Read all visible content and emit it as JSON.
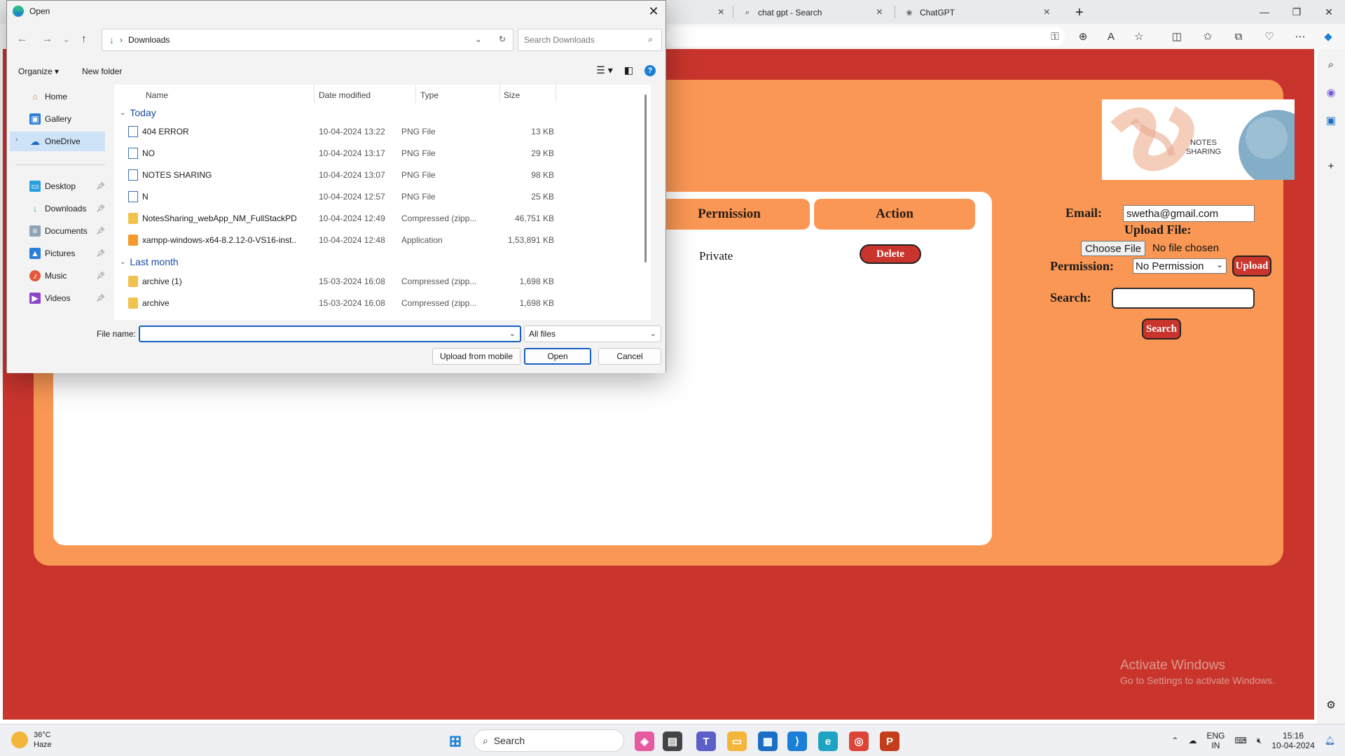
{
  "browser": {
    "tabs": [
      {
        "title": "",
        "icon": "close-icon"
      },
      {
        "title": "chat gpt - Search",
        "icon": "search-icon"
      },
      {
        "title": "ChatGPT",
        "icon": "chatgpt-icon"
      }
    ],
    "new_tab": "+"
  },
  "page": {
    "logo_text": "NOTES\nSHARING",
    "table": {
      "headers": [
        "Permission",
        "Action"
      ],
      "rows": [
        {
          "permission": "Private",
          "action": "Delete"
        }
      ]
    },
    "form": {
      "email_label": "Email:",
      "email_value": "swetha@gmail.com",
      "upload_label": "Upload File:",
      "choose_file": "Choose File",
      "no_file": "No file chosen",
      "permission_label": "Permission:",
      "permission_value": "No Permission",
      "upload_button": "Upload",
      "search_label": "Search:",
      "search_button": "Search"
    },
    "activate": {
      "line1": "Activate Windows",
      "line2": "Go to Settings to activate Windows."
    }
  },
  "dialog": {
    "title": "Open",
    "breadcrumb": "Downloads",
    "search_placeholder": "Search Downloads",
    "organize": "Organize",
    "new_folder": "New folder",
    "nav": {
      "home": "Home",
      "gallery": "Gallery",
      "onedrive": "OneDrive",
      "desktop": "Desktop",
      "downloads": "Downloads",
      "documents": "Documents",
      "pictures": "Pictures",
      "music": "Music",
      "videos": "Videos"
    },
    "columns": {
      "name": "Name",
      "date": "Date modified",
      "type": "Type",
      "size": "Size"
    },
    "groups": {
      "today": "Today",
      "last_month": "Last month"
    },
    "files_today": [
      {
        "name": "404 ERROR",
        "date": "10-04-2024 13:22",
        "type": "PNG File",
        "size": "13 KB",
        "kind": "png"
      },
      {
        "name": "NO",
        "date": "10-04-2024 13:17",
        "type": "PNG File",
        "size": "29 KB",
        "kind": "png"
      },
      {
        "name": "NOTES SHARING",
        "date": "10-04-2024 13:07",
        "type": "PNG File",
        "size": "98 KB",
        "kind": "png"
      },
      {
        "name": "N",
        "date": "10-04-2024 12:57",
        "type": "PNG File",
        "size": "25 KB",
        "kind": "png"
      },
      {
        "name": "NotesSharing_webApp_NM_FullStackPDj...",
        "date": "10-04-2024 12:49",
        "type": "Compressed (zipp...",
        "size": "46,751 KB",
        "kind": "zip"
      },
      {
        "name": "xampp-windows-x64-8.2.12-0-VS16-inst...",
        "date": "10-04-2024 12:48",
        "type": "Application",
        "size": "1,53,891 KB",
        "kind": "exe"
      }
    ],
    "files_last_month": [
      {
        "name": "archive (1)",
        "date": "15-03-2024 16:08",
        "type": "Compressed (zipp...",
        "size": "1,698 KB",
        "kind": "zip"
      },
      {
        "name": "archive",
        "date": "15-03-2024 16:08",
        "type": "Compressed (zipp...",
        "size": "1,698 KB",
        "kind": "zip"
      }
    ],
    "file_name_label": "File name:",
    "file_name_value": "",
    "filter": "All files",
    "upload_mobile": "Upload from mobile",
    "open": "Open",
    "cancel": "Cancel"
  },
  "taskbar": {
    "weather_temp": "36°C",
    "weather_desc": "Haze",
    "search_placeholder": "Search",
    "lang1": "ENG",
    "lang2": "IN",
    "time": "15:16",
    "date": "10-04-2024"
  },
  "colors": {
    "page_bg": "#c9352d",
    "panel": "#fa9754",
    "button": "#c9352d"
  }
}
